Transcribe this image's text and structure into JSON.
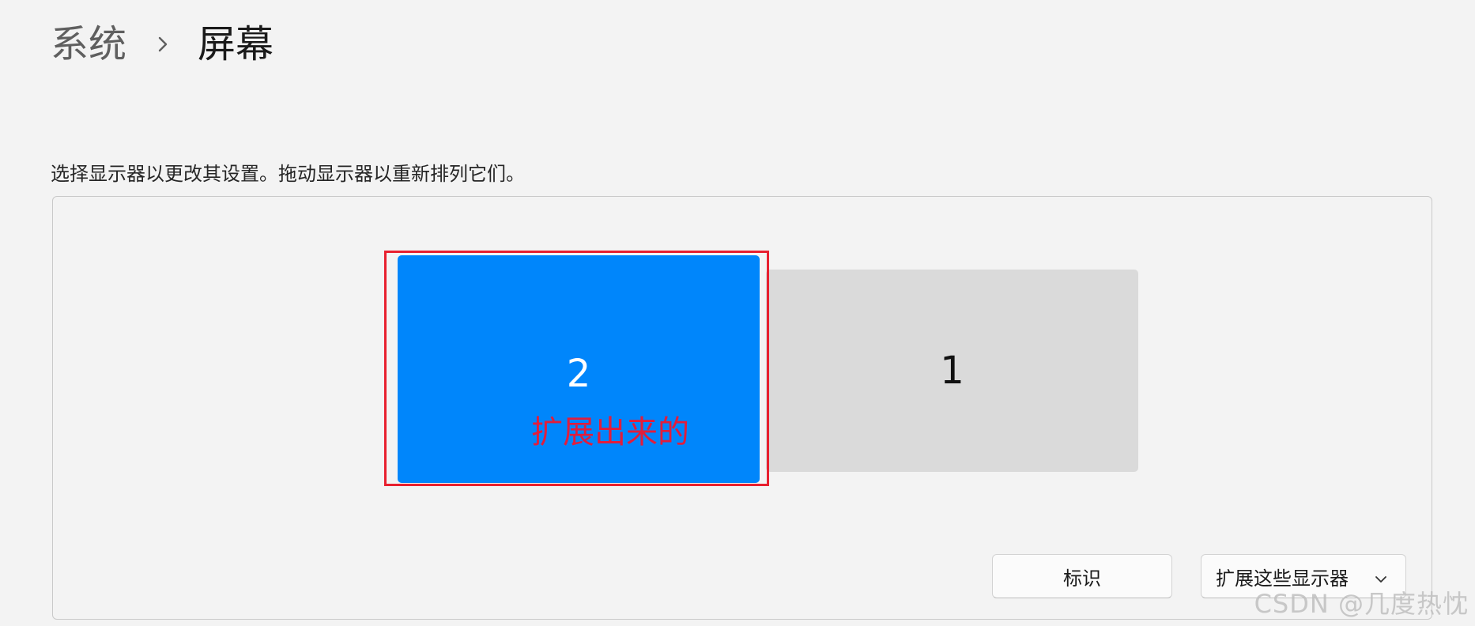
{
  "breadcrumb": {
    "parent": "系统",
    "current": "屏幕"
  },
  "instruction": "选择显示器以更改其设置。拖动显示器以重新排列它们。",
  "displays": {
    "secondary": {
      "number": "2",
      "annotation": "扩展出来的",
      "color": "#0086fb"
    },
    "primary": {
      "number": "1",
      "color": "#dadada"
    },
    "highlight_color": "#e8202f"
  },
  "buttons": {
    "identify": "标识",
    "mode": "扩展这些显示器"
  },
  "watermark": "CSDN @几度热忱",
  "icons": {
    "breadcrumb_separator": "chevron-right-icon",
    "dropdown": "chevron-down-icon"
  }
}
